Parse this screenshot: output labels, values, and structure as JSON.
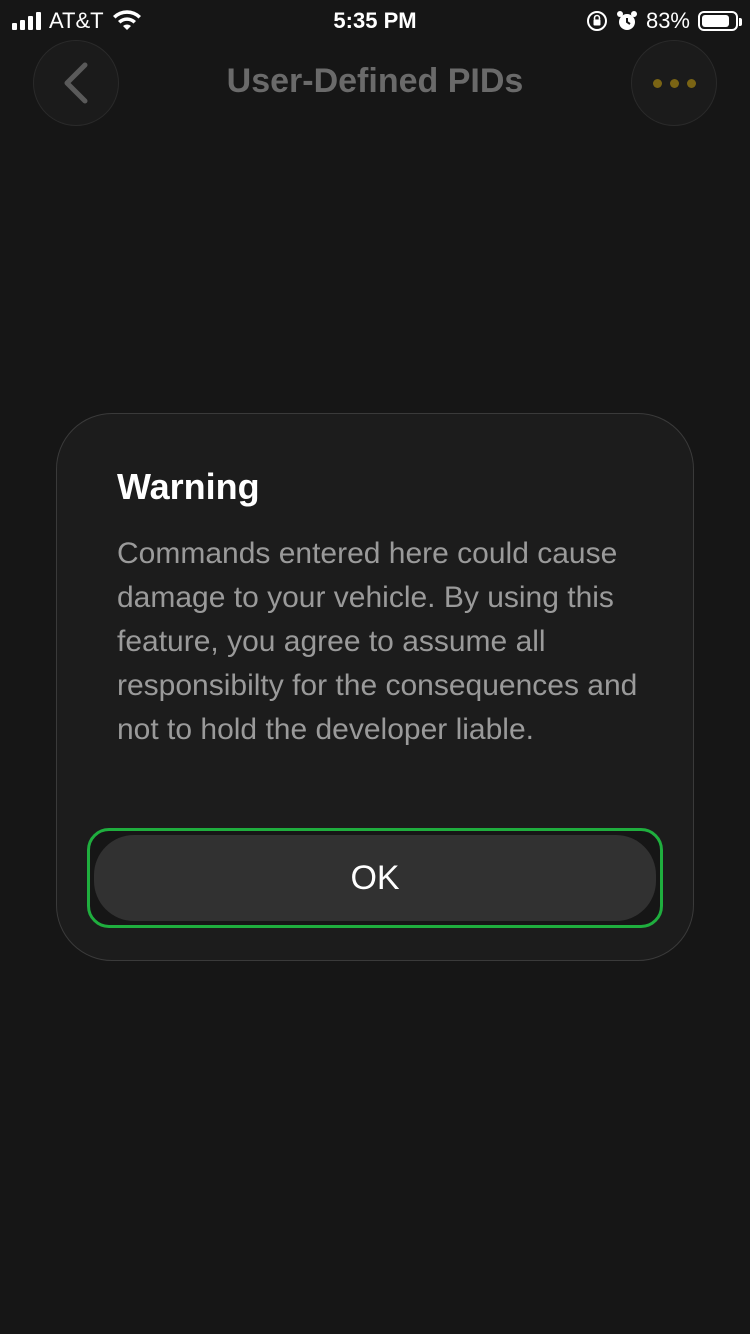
{
  "status_bar": {
    "carrier": "AT&T",
    "time": "5:35 PM",
    "battery": "83%",
    "battery_level": 0.83
  },
  "nav": {
    "title": "User-Defined PIDs",
    "back_icon": "chevron-left-icon",
    "more_icon": "ellipsis-icon"
  },
  "modal": {
    "title": "Warning",
    "message": "Commands entered here could cause damage to your vehicle. By using this feature, you agree to assume all responsibilty for the consequences and not to hold the developer liable.",
    "ok_label": "OK"
  },
  "colors": {
    "background": "#161616",
    "accent_gold": "#7a6414",
    "focus_green": "#1fae3e"
  }
}
